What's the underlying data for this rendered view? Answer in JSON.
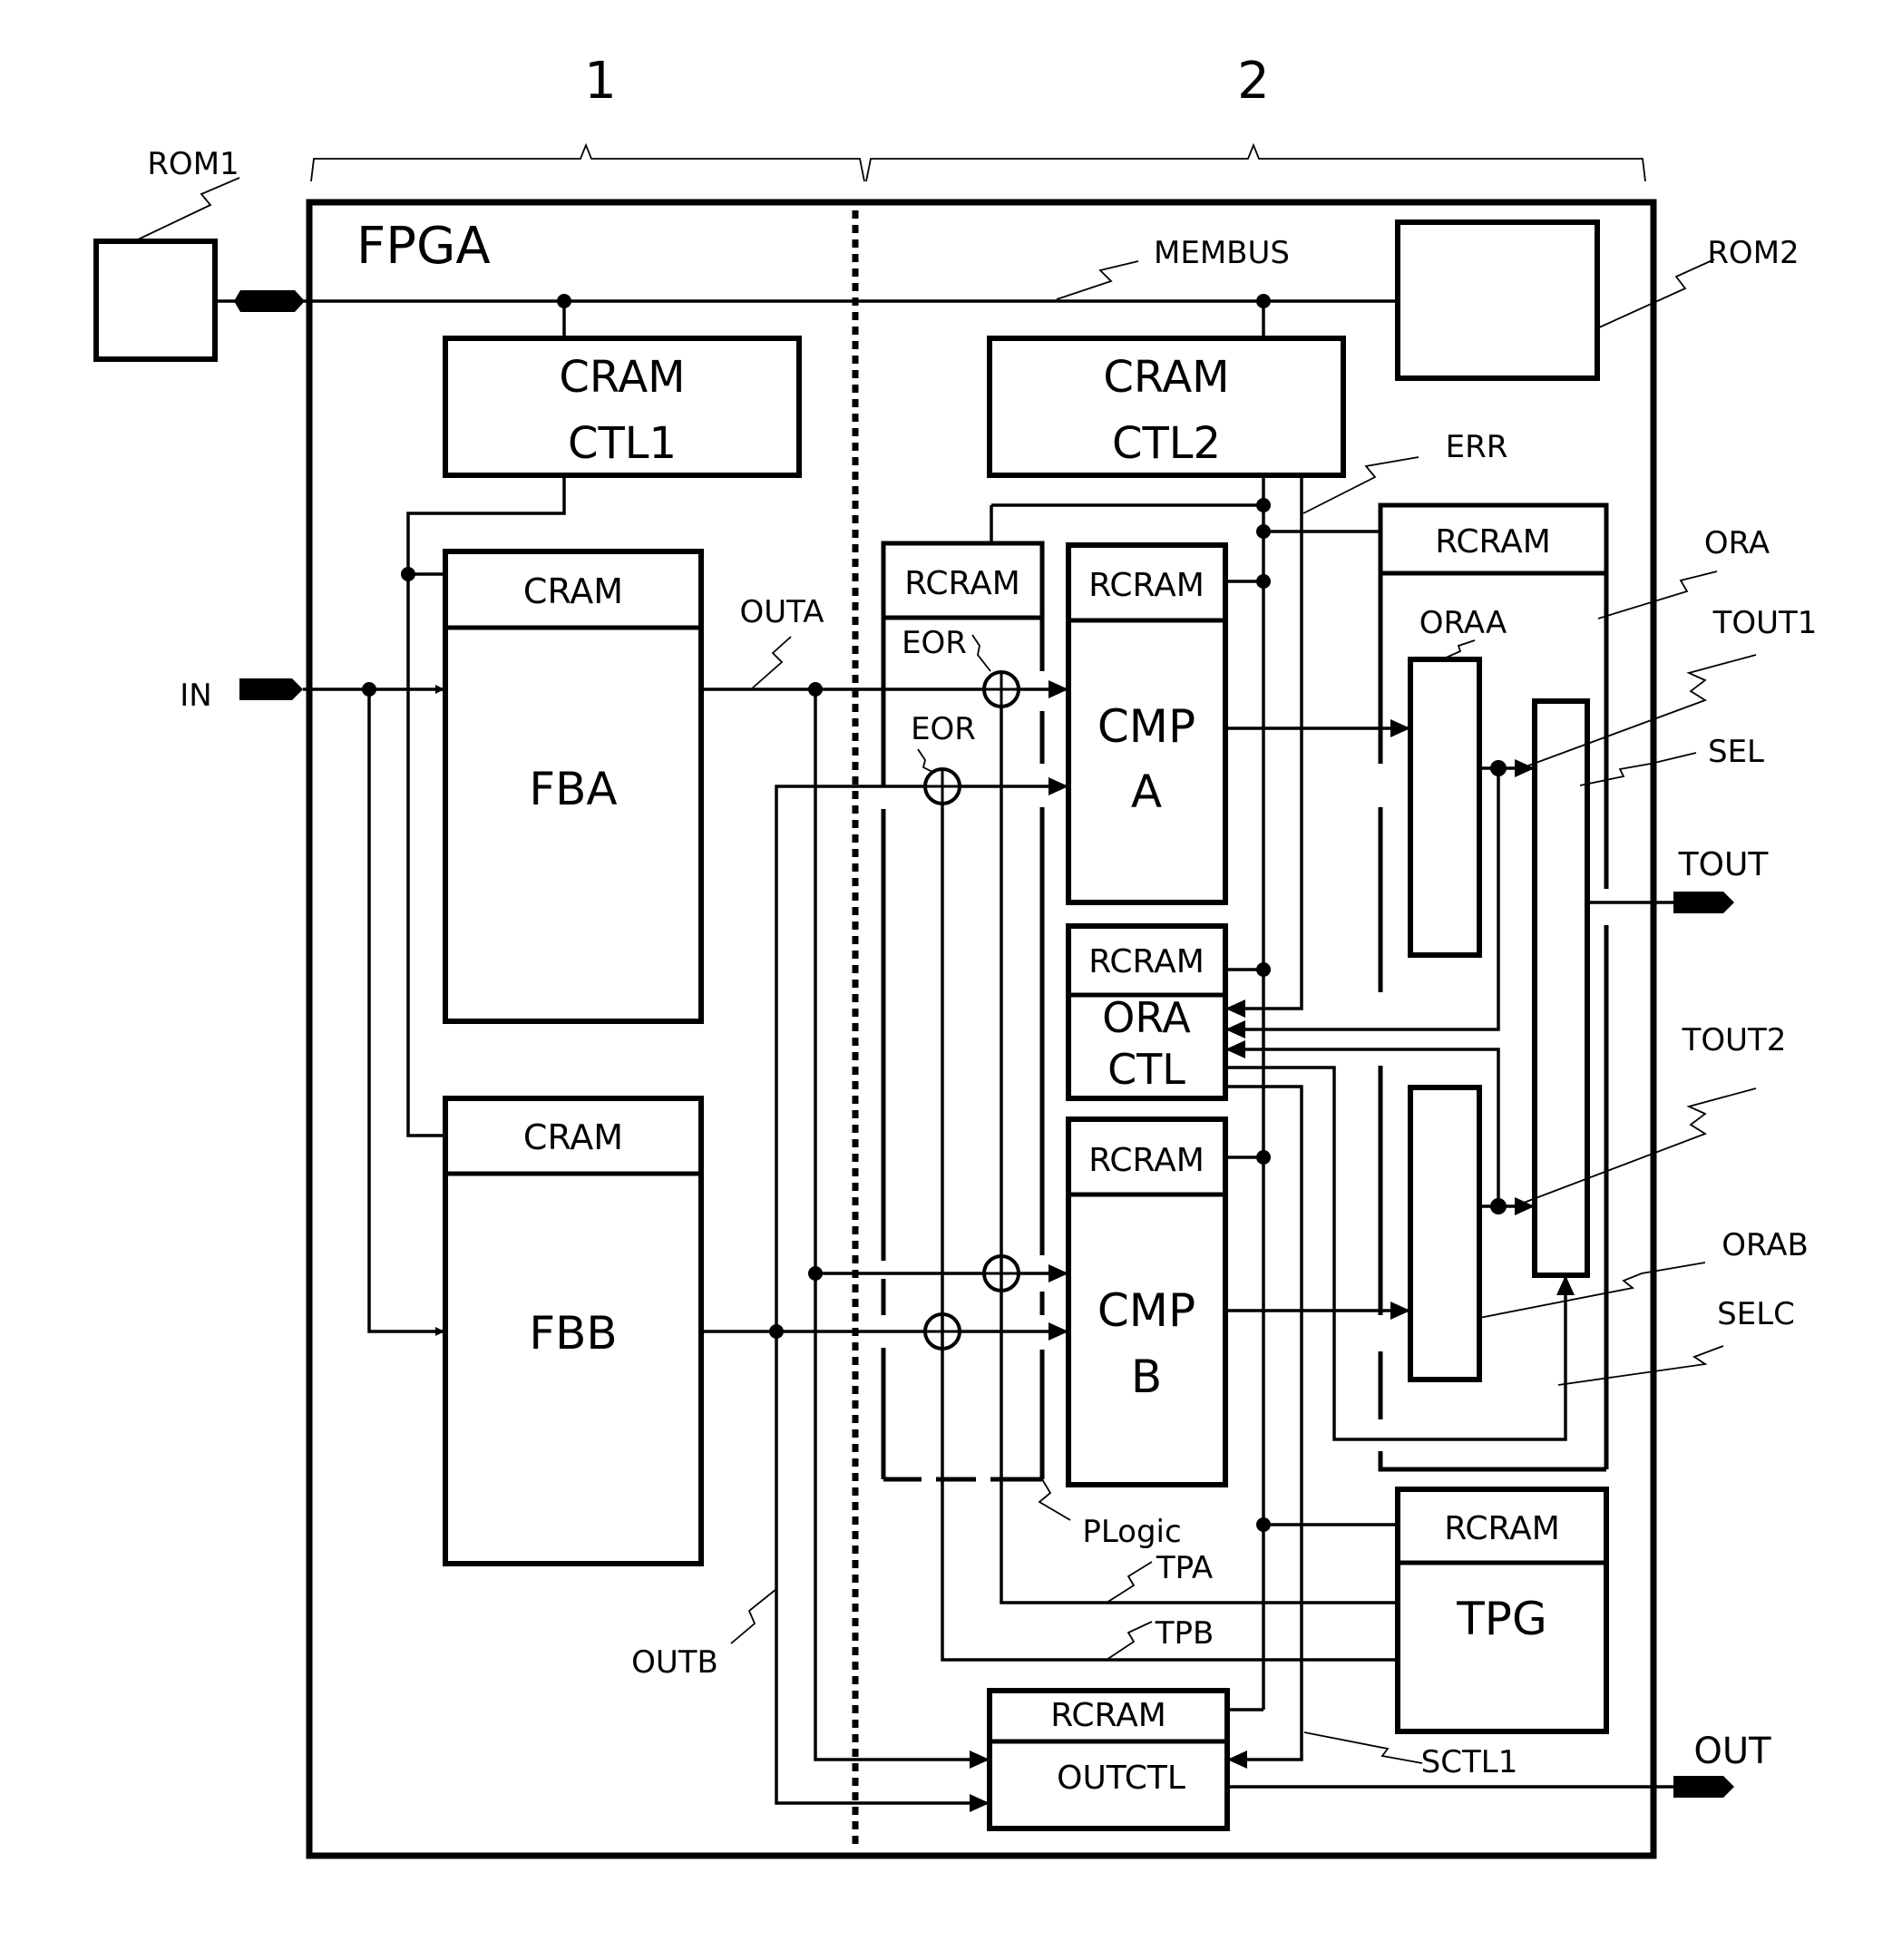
{
  "brackets": {
    "left": "1",
    "right": "2"
  },
  "chip": {
    "title": "FPGA",
    "divider": "dotted partition between region 1 and region 2"
  },
  "external": {
    "rom1": "ROM1",
    "rom2": "ROM2"
  },
  "buses": {
    "membus": "MEMBUS",
    "err": "ERR",
    "sctl1": "SCTL1"
  },
  "blocks": {
    "cramctl1": {
      "line1": "CRAM",
      "line2": "CTL1"
    },
    "cramctl2": {
      "line1": "CRAM",
      "line2": "CTL2"
    },
    "fba": {
      "header": "CRAM",
      "label": "FBA"
    },
    "fbb": {
      "header": "CRAM",
      "label": "FBB"
    },
    "plogic": {
      "header": "RCRAM",
      "label": "PLogic"
    },
    "cmpa": {
      "header": "RCRAM",
      "line1": "CMP",
      "line2": "A"
    },
    "oractl": {
      "header": "RCRAM",
      "line1": "ORA",
      "line2": "CTL"
    },
    "cmpb": {
      "header": "RCRAM",
      "line1": "CMP",
      "line2": "B"
    },
    "ora": {
      "header": "RCRAM",
      "label": "ORA",
      "sub_a": "ORAA",
      "sub_b": "ORAB",
      "sel": "SEL",
      "selc": "SELC"
    },
    "tpg": {
      "header": "RCRAM",
      "label": "TPG"
    },
    "outctl": {
      "header": "RCRAM",
      "label": "OUTCTL"
    }
  },
  "signals": {
    "in": "IN",
    "out": "OUT",
    "tout": "TOUT",
    "tout1": "TOUT1",
    "tout2": "TOUT2",
    "outa": "OUTA",
    "outb": "OUTB",
    "eor1": "EOR",
    "eor2": "EOR",
    "tpa": "TPA",
    "tpb": "TPB"
  }
}
